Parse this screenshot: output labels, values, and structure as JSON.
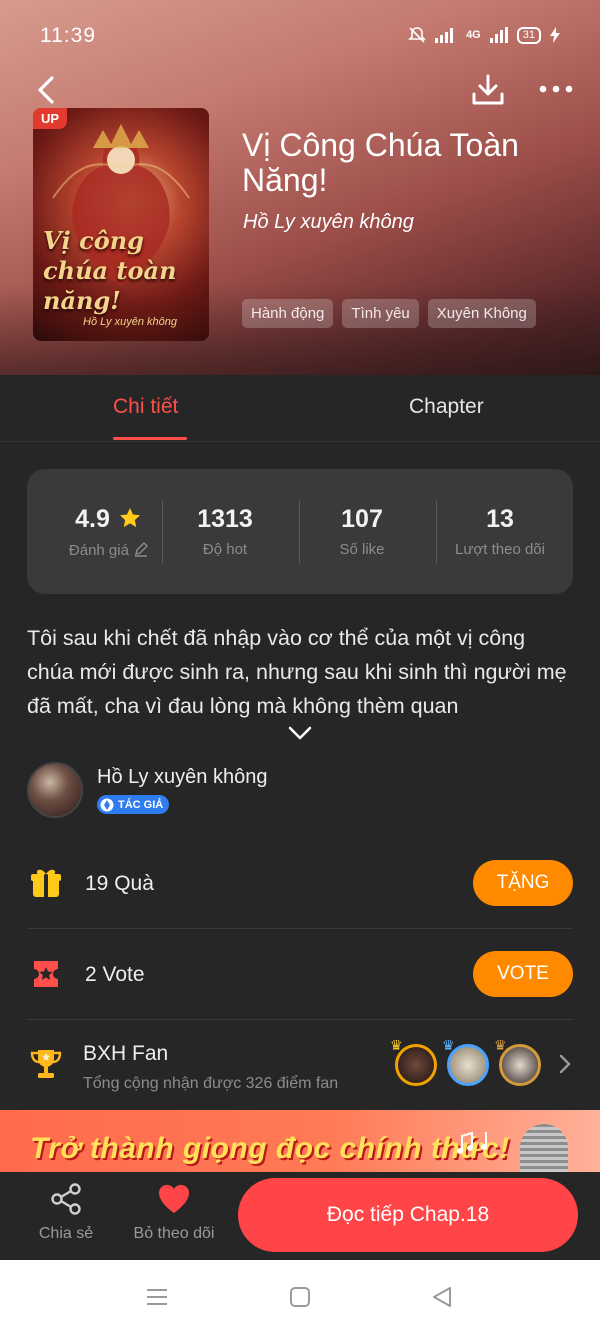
{
  "status_bar": {
    "time": "11:39",
    "network": "4G",
    "battery": "31"
  },
  "book": {
    "title": "Vị Công Chúa Toàn Năng!",
    "author": "Hồ Ly xuyên không",
    "cover_badge": "UP",
    "cover_title": "Vị công chúa toàn năng!",
    "tags": [
      "Hành động",
      "Tình yêu",
      "Xuyên Không"
    ]
  },
  "tabs": {
    "details": "Chi tiết",
    "chapter": "Chapter"
  },
  "stats": [
    {
      "value": "4.9",
      "label": "Đánh giá"
    },
    {
      "value": "1313",
      "label": "Độ hot"
    },
    {
      "value": "107",
      "label": "Số like"
    },
    {
      "value": "13",
      "label": "Lượt theo dõi"
    }
  ],
  "description": "Tôi sau khi chết đã nhập vào cơ thể của một vị công chúa mới được sinh ra, nhưng sau khi sinh thì người mẹ đã mất, cha vì đau lòng mà không thèm quan",
  "author_block": {
    "name": "Hồ Ly xuyên không",
    "badge": "TÁC GIẢ"
  },
  "gifts": {
    "label": "19 Quà",
    "button": "TẶNG"
  },
  "votes": {
    "label": "2 Vote",
    "button": "VOTE"
  },
  "fan_rank": {
    "title": "BXH Fan",
    "subtitle": "Tổng cộng nhận được 326 điểm fan"
  },
  "banner": {
    "text": "Trở thành giọng đọc chính thức!"
  },
  "actions": {
    "share": "Chia sẻ",
    "unfollow": "Bỏ theo dõi",
    "continue": "Đọc tiếp Chap.18"
  },
  "colors": {
    "accent": "#ff4548",
    "orange": "#ff8a00",
    "background": "#262626"
  }
}
